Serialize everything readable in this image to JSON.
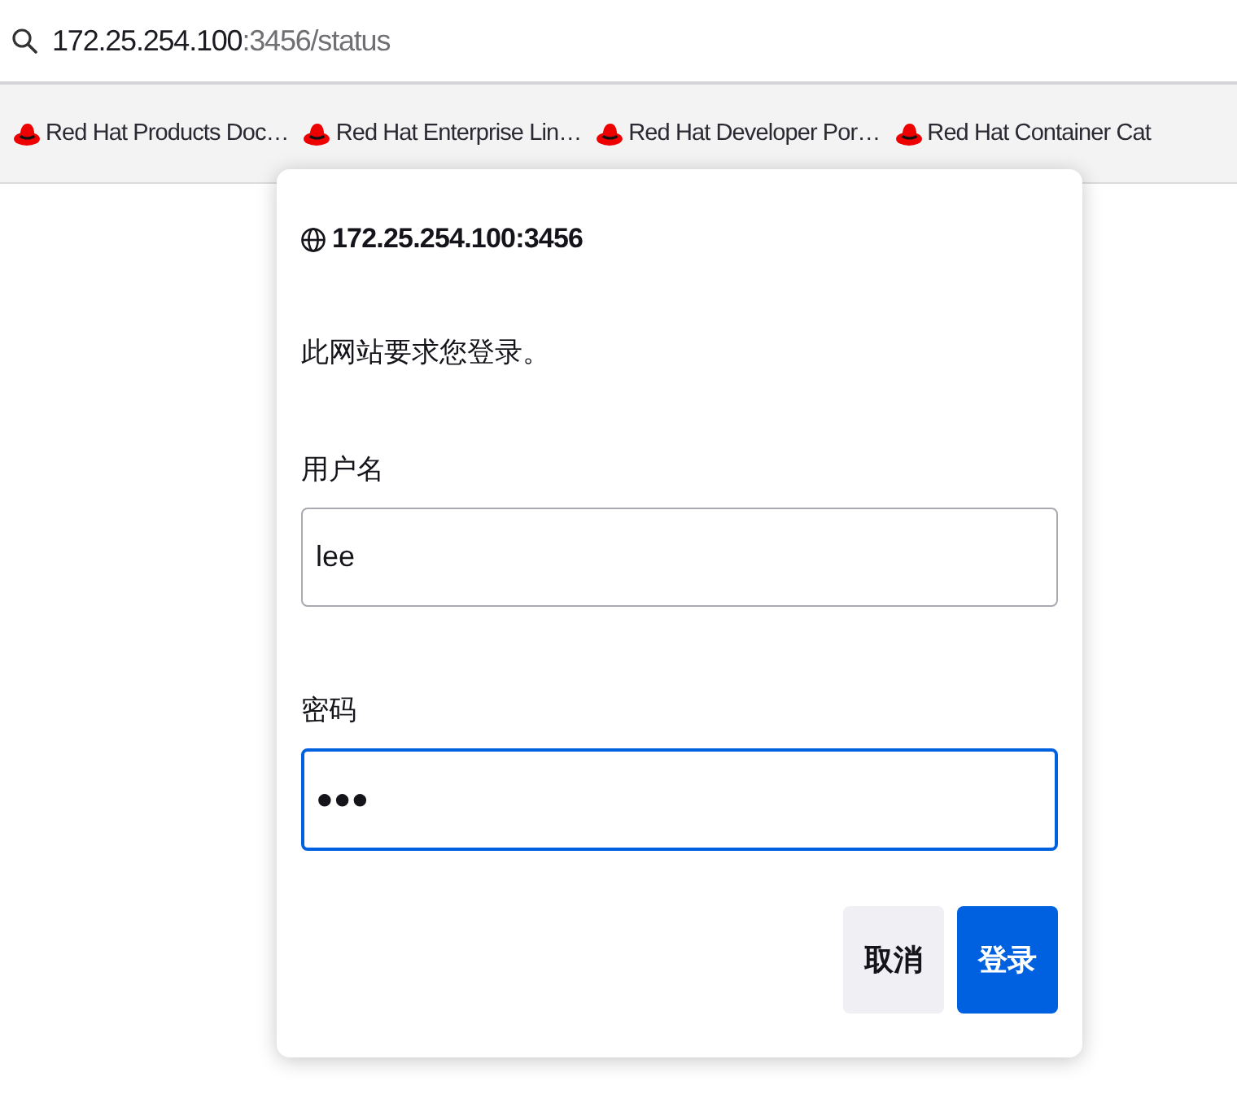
{
  "address_bar": {
    "host": "172.25.254.100",
    "path": ":3456/status"
  },
  "bookmarks": [
    {
      "label": "Red Hat Products Doc…"
    },
    {
      "label": "Red Hat Enterprise Lin…"
    },
    {
      "label": "Red Hat Developer Por…"
    },
    {
      "label": "Red Hat Container Cat"
    }
  ],
  "dialog": {
    "title": "172.25.254.100:3456",
    "message": "此网站要求您登录。",
    "fields": [
      {
        "label": "用户名",
        "value": "lee",
        "focused": false
      },
      {
        "label": "密码",
        "value": "●●●",
        "focused": true
      }
    ],
    "buttons": [
      {
        "label": "取消",
        "kind": "secondary"
      },
      {
        "label": "登录",
        "kind": "primary"
      }
    ]
  }
}
